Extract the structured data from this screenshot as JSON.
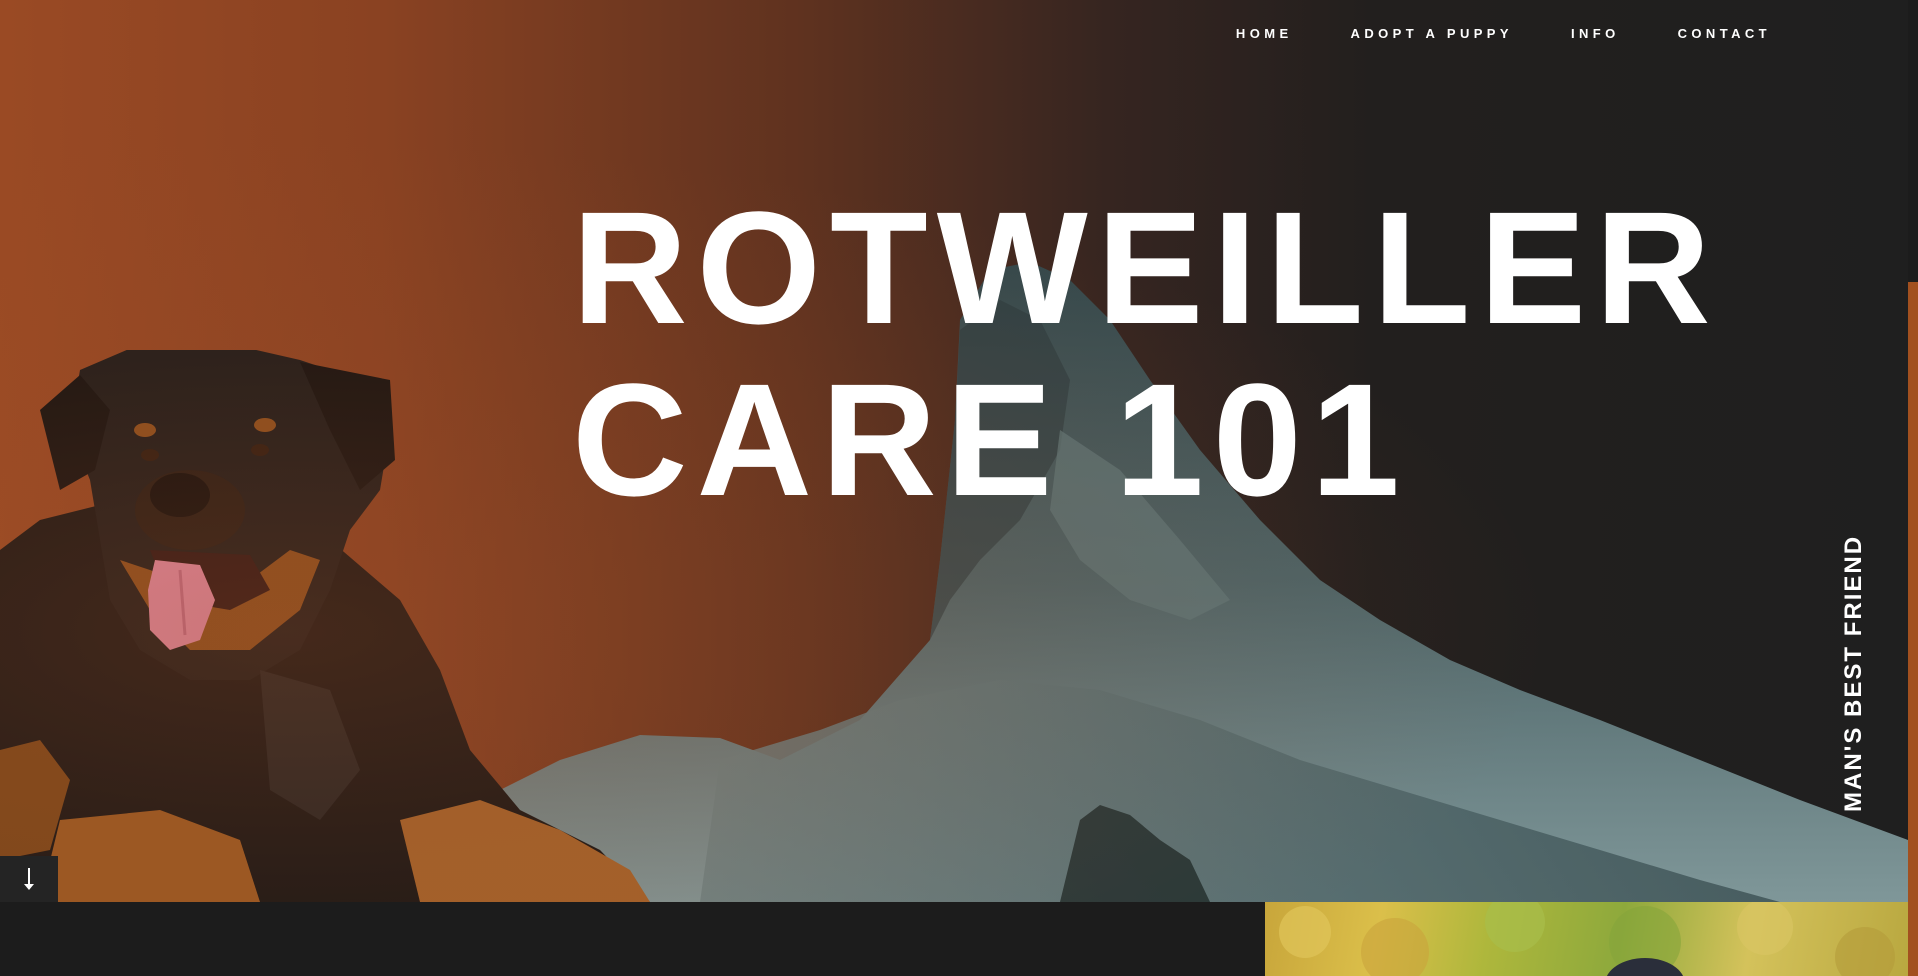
{
  "nav": {
    "items": [
      {
        "label": "HOME"
      },
      {
        "label": "ADOPT A PUPPY"
      },
      {
        "label": "INFO"
      },
      {
        "label": "CONTACT"
      }
    ]
  },
  "hero": {
    "title_line1": "ROTWEILLER",
    "title_line2": "CARE 101",
    "tagline": "MAN'S BEST FRIEND"
  },
  "colors": {
    "accent": "#a2501f",
    "background": "#1c1c1c",
    "text": "#ffffff"
  },
  "icons": {
    "scroll": "arrow-down-icon"
  }
}
